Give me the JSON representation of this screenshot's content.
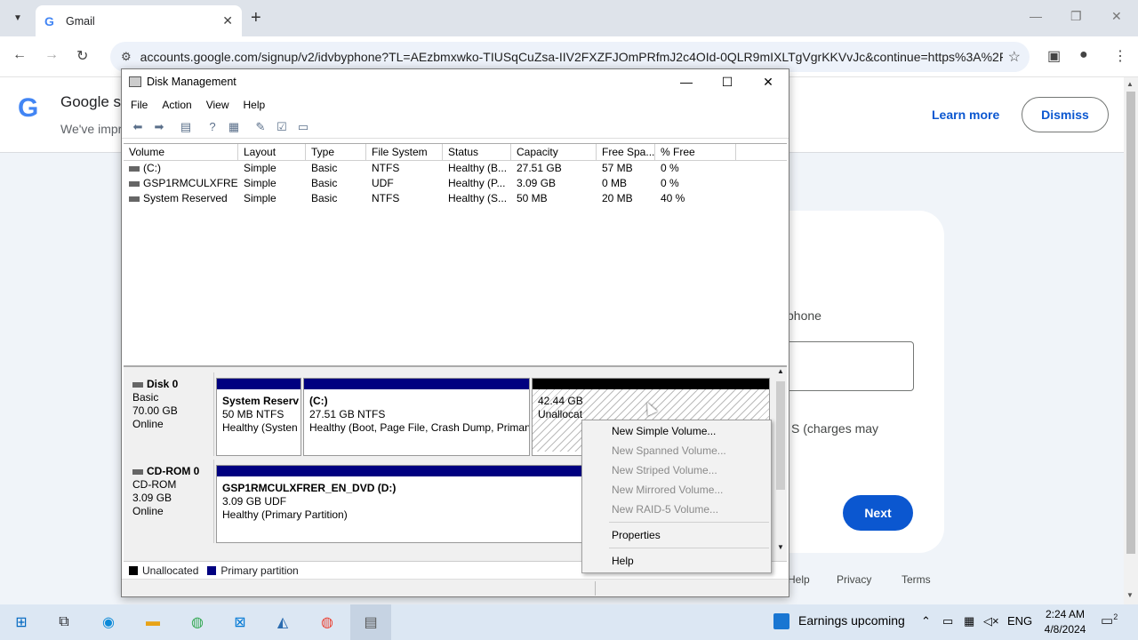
{
  "browser": {
    "tab_title": "Gmail",
    "tab_close": "✕",
    "new_tab": "+",
    "url": "accounts.google.com/signup/v2/idvbyphone?TL=AEzbmxwko-TIUSqCuZsa-IIV2FXZFJOmPRfmJ2c4OId-0QLR9mIXLTgVgrKKVvJc&continue=https%3A%2F%...",
    "win_min": "—",
    "win_max": "❐",
    "win_close": "✕"
  },
  "google": {
    "logo": "G",
    "banner_title": "Google s",
    "banner_sub": "We've impr",
    "learn_more": "Learn more",
    "dismiss": "Dismiss",
    "phone_label": "phone",
    "sms_text": "S (charges may",
    "next": "Next",
    "footer": [
      "Help",
      "Privacy",
      "Terms"
    ]
  },
  "disk_mgmt": {
    "title": "Disk Management",
    "menu": [
      "File",
      "Action",
      "View",
      "Help"
    ],
    "columns": [
      "Volume",
      "Layout",
      "Type",
      "File System",
      "Status",
      "Capacity",
      "Free Spa...",
      "% Free"
    ],
    "rows": [
      [
        "(C:)",
        "Simple",
        "Basic",
        "NTFS",
        "Healthy (B...",
        "27.51 GB",
        "57 MB",
        "0 %"
      ],
      [
        "GSP1RMCULXFRE...",
        "Simple",
        "Basic",
        "UDF",
        "Healthy (P...",
        "3.09 GB",
        "0 MB",
        "0 %"
      ],
      [
        "System Reserved",
        "Simple",
        "Basic",
        "NTFS",
        "Healthy (S...",
        "50 MB",
        "20 MB",
        "40 %"
      ]
    ],
    "disk0": {
      "name": "Disk 0",
      "type": "Basic",
      "size": "70.00 GB",
      "status": "Online",
      "partitions": [
        {
          "name": "System Reserv",
          "detail": "50 MB NTFS",
          "status": "Healthy (Systen"
        },
        {
          "name": "(C:)",
          "detail": "27.51 GB NTFS",
          "status": "Healthy (Boot, Page File, Crash Dump, Priman"
        },
        {
          "name": "",
          "detail": "42.44 GB",
          "status": "Unallocat"
        }
      ]
    },
    "cdrom0": {
      "name": "CD-ROM 0",
      "type": "CD-ROM",
      "size": "3.09 GB",
      "status": "Online",
      "partition": {
        "name": "GSP1RMCULXFRER_EN_DVD  (D:)",
        "detail": "3.09 GB UDF",
        "status": "Healthy (Primary Partition)"
      }
    },
    "legend": {
      "unallocated": "Unallocated",
      "primary": "Primary partition"
    }
  },
  "context_menu": {
    "items": [
      {
        "label": "New Simple Volume...",
        "enabled": true
      },
      {
        "label": "New Spanned Volume...",
        "enabled": false
      },
      {
        "label": "New Striped Volume...",
        "enabled": false
      },
      {
        "label": "New Mirrored Volume...",
        "enabled": false
      },
      {
        "label": "New RAID-5 Volume...",
        "enabled": false
      }
    ],
    "properties": "Properties",
    "help": "Help"
  },
  "taskbar": {
    "weather": "Earnings upcoming",
    "lang": "ENG",
    "time": "2:24 AM",
    "date": "4/8/2024",
    "notifications": "2"
  },
  "colors": {
    "primary_partition": "#000080",
    "unallocated": "#000000",
    "google_blue": "#0b57d0"
  }
}
